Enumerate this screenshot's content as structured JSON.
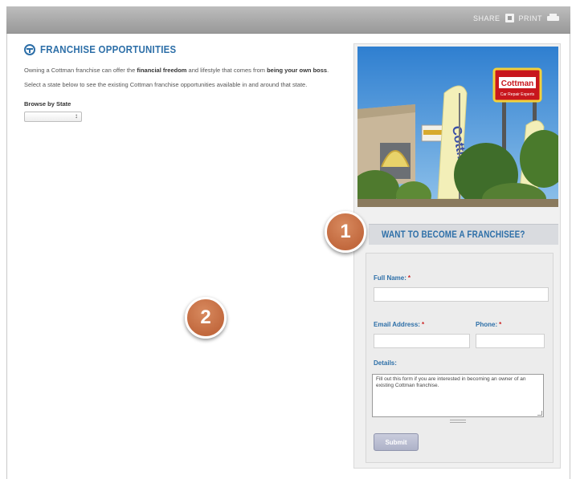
{
  "toolbar": {
    "share_label": "SHARE",
    "print_label": "PRINT"
  },
  "main": {
    "heading": "FRANCHISE OPPORTUNITIES",
    "intro_text_1": "Owning a Cottman franchise can offer the ",
    "intro_bold_1": "financial freedom",
    "intro_text_2": " and lifestyle that comes from ",
    "intro_bold_2": "being your own boss",
    "intro_text_3": ".",
    "select_hint": "Select a state below to see the existing Cottman franchise opportunities available in and around that state.",
    "browse_label": "Browse by State",
    "state_select_value": ""
  },
  "sidebar": {
    "photo_sign_text": "Cottman",
    "photo_sign_subtext": "Car Repair Experts",
    "photo_banner_text": "Cottman",
    "form_title": "WANT TO BECOME A FRANCHISEE?",
    "full_name_label": "Full Name:",
    "email_label": "Email Address:",
    "phone_label": "Phone:",
    "required_mark": "*",
    "details_label": "Details:",
    "details_placeholder": "Fill out this form if you are interested in becoming an owner of an existing Cottman franchise.",
    "submit_label": "Submit"
  },
  "callouts": [
    "1",
    "2"
  ],
  "colors": {
    "accent_blue": "#2d6fa8",
    "callout_orange": "#c2693e",
    "required_red": "#cc2222"
  }
}
